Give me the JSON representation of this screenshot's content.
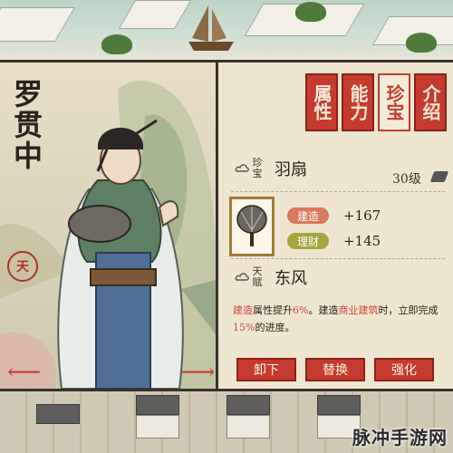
{
  "character": {
    "name": "罗贯中",
    "seal": "天"
  },
  "tabs": [
    {
      "label": "属性",
      "active": false
    },
    {
      "label": "能力",
      "active": false
    },
    {
      "label": "珍宝",
      "active": true
    },
    {
      "label": "介绍",
      "active": false
    }
  ],
  "treasure": {
    "section_label": "珍宝",
    "name": "羽扇",
    "level": "30级",
    "stats": [
      {
        "label": "建造",
        "value": "+167",
        "color": "#d9785b"
      },
      {
        "label": "理财",
        "value": "+145",
        "color": "#a5a73e"
      }
    ]
  },
  "talent": {
    "section_label": "天赋",
    "name": "东风",
    "desc_parts": [
      {
        "text": "建造",
        "hl": true
      },
      {
        "text": "属性提升",
        "hl": false
      },
      {
        "text": "6%",
        "hl": true
      },
      {
        "text": "。建造",
        "hl": false
      },
      {
        "text": "商业建筑",
        "hl": true
      },
      {
        "text": "时，立即完成",
        "hl": false
      },
      {
        "text": "15%",
        "hl": true
      },
      {
        "text": "的进度。",
        "hl": false
      }
    ]
  },
  "buttons": {
    "unequip": "卸下",
    "replace": "替换",
    "enhance": "强化"
  },
  "watermark": "脉冲手游网",
  "colors": {
    "accent_red": "#c53b2e",
    "highlight_red": "#d14a3a",
    "panel_bg": "#efe6d0"
  }
}
